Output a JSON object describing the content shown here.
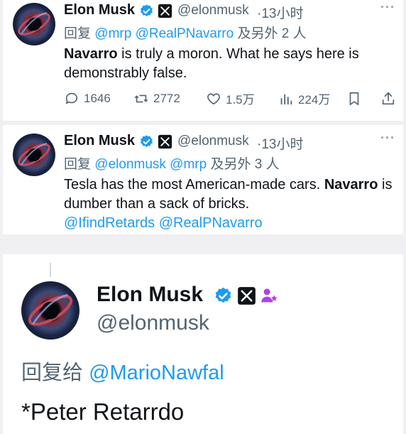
{
  "tweets": [
    {
      "name": "Elon Musk",
      "handle": "@elonmusk",
      "time": "·13小时",
      "reply_prefix": "回复",
      "reply_mentions": "@mrp @RealPNavarro",
      "reply_suffix": "及另外 2 人",
      "text_bold": "Navarro",
      "text_rest": " is truly a moron. What he says here is demonstrably false.",
      "stats": {
        "replies": "1646",
        "retweets": "2772",
        "likes": "1.5万",
        "views": "224万"
      }
    },
    {
      "name": "Elon Musk",
      "handle": "@elonmusk",
      "time": "·13小时",
      "reply_prefix": "回复",
      "reply_mentions": "@elonmusk @mrp",
      "reply_suffix": "及另外 3 人",
      "text_pre": "Tesla has the most American-made cars. ",
      "text_bold": "Navarro",
      "text_post": " is dumber than a sack of bricks.",
      "mentions_line": "@IfindRetards @RealPNavarro"
    },
    {
      "name": "Elon Musk",
      "handle": "@elonmusk",
      "reply_prefix": "回复给",
      "reply_mention": "@MarioNawfal",
      "text": "*Peter Retarrdo"
    }
  ],
  "colors": {
    "link": "#1d9bf0",
    "secondary": "#536471",
    "verified": "#1d9bf0",
    "affiliate": "#b042e8"
  },
  "icons": [
    "verified-icon",
    "x-logo-icon",
    "affiliate-badge-icon",
    "more-icon",
    "reply-icon",
    "retweet-icon",
    "like-icon",
    "views-icon",
    "bookmark-icon",
    "share-icon"
  ]
}
